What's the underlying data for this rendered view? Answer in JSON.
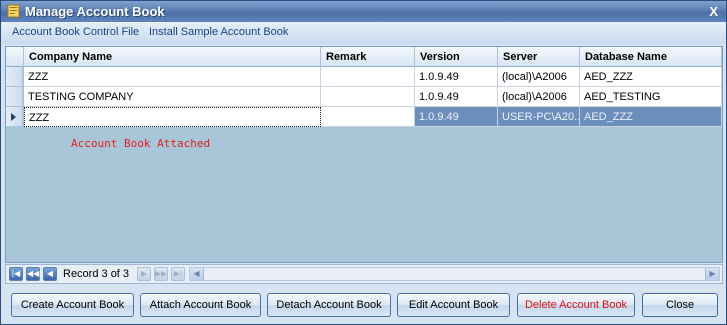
{
  "window": {
    "title": "Manage Account Book",
    "close_label": "X"
  },
  "menu": {
    "items": [
      "Account Book Control File",
      "Install Sample Account Book"
    ]
  },
  "grid": {
    "columns": [
      "Company Name",
      "Remark",
      "Version",
      "Server",
      "Database Name"
    ],
    "rows": [
      [
        "ZZZ",
        "",
        "1.0.9.49",
        "(local)\\A2006",
        "AED_ZZZ"
      ],
      [
        "TESTING COMPANY",
        "",
        "1.0.9.49",
        "(local)\\A2006",
        "AED_TESTING"
      ],
      [
        "ZZZ",
        "",
        "1.0.9.49",
        "USER-PC\\A20...",
        "AED_ZZZ"
      ]
    ],
    "selected_row": 3
  },
  "message": "Account Book Attached",
  "navigator": {
    "record_text": "Record 3 of 3"
  },
  "buttons": {
    "create": "Create Account Book",
    "attach": "Attach Account Book",
    "detach": "Detach Account Book",
    "edit": "Edit Account Book",
    "delete": "Delete Account Book",
    "close": "Close"
  },
  "colors": {
    "title_bar": "#5b7fb3",
    "grid_background": "#a9c6d9",
    "selected_row": "#6b8ebc",
    "message_text": "#e02020",
    "delete_text": "#e01010"
  }
}
